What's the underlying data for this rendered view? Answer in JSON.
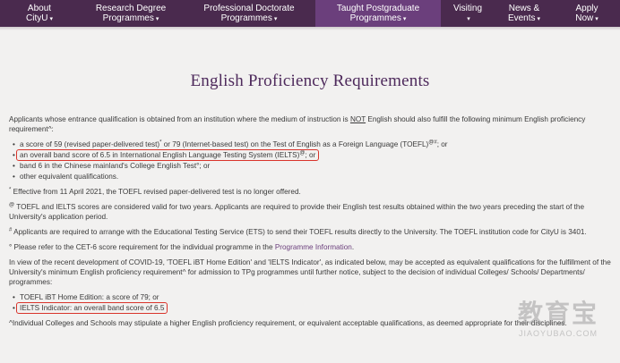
{
  "nav": {
    "items": [
      {
        "line1": "About",
        "line2": "CityU",
        "caret": "▾"
      },
      {
        "line1": "Research Degree",
        "line2": "Programmes",
        "caret": "▾"
      },
      {
        "line1": "Professional Doctorate",
        "line2": "Programmes",
        "caret": "▾"
      },
      {
        "line1": "Taught Postgraduate",
        "line2": "Programmes",
        "caret": "▾"
      },
      {
        "line1": "Visiting",
        "line2": "",
        "caret": "▾"
      },
      {
        "line1": "News &",
        "line2": "Events",
        "caret": "▾"
      },
      {
        "line1": "Apply",
        "line2": "Now",
        "caret": "▾"
      }
    ]
  },
  "page": {
    "title": "English Proficiency Requirements",
    "intro_a": "Applicants whose entrance qualification is obtained from an institution where the medium of instruction is ",
    "intro_not": "NOT",
    "intro_b": " English should also fulfill the following minimum English proficiency requirement^:",
    "reqs": {
      "toefl_a": "a score of 59 (revised paper-delivered test)",
      "toefl_sup1": "*",
      "toefl_b": " or 79 (Internet-based test) on the Test of English as a Foreign Language (TOEFL)",
      "toefl_sup2": "@#",
      "toefl_c": "; or",
      "ielts": "an overall band score of 6.5 in International English Language Testing System (IELTS)",
      "ielts_sup": "@",
      "ielts_c": "; or",
      "cet": "band 6 in the Chinese mainland's College English Test°; or",
      "other": "other equivalent qualifications."
    },
    "note1_sym": "*",
    "note1": " Effective from 11 April 2021, the TOEFL revised paper-delivered test is no longer offered.",
    "note2_sym": "@",
    "note2": " TOEFL and IELTS scores are considered valid for two years. Applicants are required to provide their English test results obtained within the two years preceding the start of the University's application period.",
    "note3_sym": "#",
    "note3": " Applicants are required to arrange with the Educational Testing Service (ETS) to send their TOEFL results directly to the University. The TOEFL institution code for CityU is 3401.",
    "note4_a": "° Please refer to the CET-6 score requirement for the individual programme in the ",
    "note4_link": "Programme Information",
    "note4_b": ".",
    "covid": "In view of the recent development of COVID-19, 'TOEFL iBT Home Edition' and 'IELTS Indicator', as indicated below, may be accepted as equivalent qualifications for the fulfillment of the University's minimum English proficiency requirement^ for admission to TPg programmes until further notice, subject to the decision of individual Colleges/ Schools/ Departments/ programmes:",
    "alt1": "TOEFL iBT Home Edition: a score of 79; or",
    "alt2": "IELTS Indicator: an overall band score of 6.5",
    "footer": "^Individual Colleges and Schools may stipulate a higher English proficiency requirement, or equivalent acceptable qualifications, as deemed appropriate for their disciplines."
  },
  "watermark": {
    "logo": "教育宝",
    "url": "JIAOYUBAO.COM"
  },
  "colors": {
    "nav_bg": "#4a2a4e",
    "nav_active": "#6b3f7c",
    "title": "#4e2a5c",
    "highlight_box": "#d9342b"
  }
}
